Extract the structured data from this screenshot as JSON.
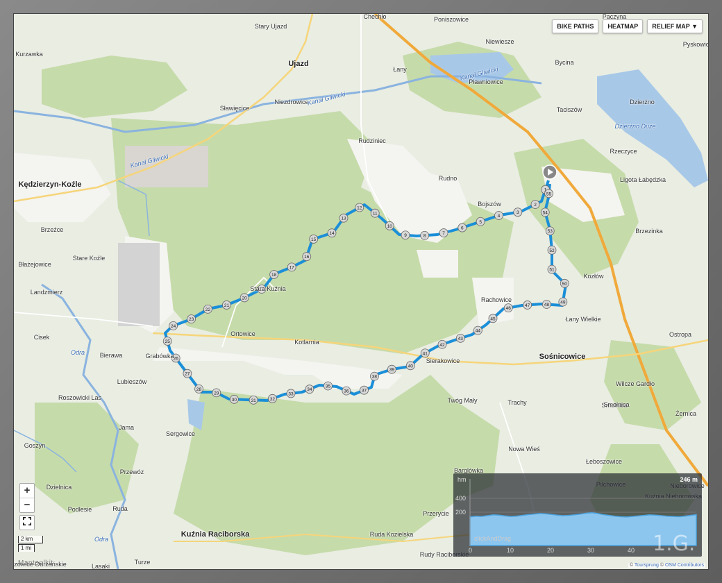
{
  "map": {
    "buttons": {
      "bike_paths": "BIKE PATHS",
      "heatmap": "HEATMAP",
      "relief_map": "RELIEF MAP ▼"
    },
    "zoom": {
      "in": "+",
      "out": "−"
    },
    "fullscreen_icon": "expand-icon",
    "scale": {
      "km": "2 km",
      "mi": "1 mi"
    },
    "logo": "Maptoolkit",
    "credits": {
      "prefix": "©",
      "toursprung": "Toursprung",
      "sep": "©",
      "osm": "OSM Contributors"
    },
    "watermark": "1.G.",
    "route_color": "#1b8fd8",
    "towns": [
      {
        "name": "Kędzierzyn-Koźle",
        "major": true
      },
      {
        "name": "Ujazd",
        "major": true
      },
      {
        "name": "Sośnicowice",
        "major": true
      },
      {
        "name": "Kuźnia Raciborska",
        "major": true
      },
      {
        "name": "Chechło"
      },
      {
        "name": "Poniszowice"
      },
      {
        "name": "Paczyna"
      },
      {
        "name": "Stary Ujazd"
      },
      {
        "name": "Kurzawka"
      },
      {
        "name": "Niewiesze"
      },
      {
        "name": "Łany"
      },
      {
        "name": "Bycina"
      },
      {
        "name": "Pławniowice"
      },
      {
        "name": "Sławięcice"
      },
      {
        "name": "Niezdrowice"
      },
      {
        "name": "Taciszów"
      },
      {
        "name": "Dzierżno"
      },
      {
        "name": "Rudziniec"
      },
      {
        "name": "Rzeczyce"
      },
      {
        "name": "Rudno"
      },
      {
        "name": "Ligota Łabędzka"
      },
      {
        "name": "Bojszów"
      },
      {
        "name": "Brzezinka"
      },
      {
        "name": "Brzeźce"
      },
      {
        "name": "Stare Koźle"
      },
      {
        "name": "Błażejowice"
      },
      {
        "name": "Landzmierz"
      },
      {
        "name": "Stara Kuźnia"
      },
      {
        "name": "Kozłów"
      },
      {
        "name": "Łany Wielkie"
      },
      {
        "name": "Rachowice"
      },
      {
        "name": "Cisek"
      },
      {
        "name": "Bierawa"
      },
      {
        "name": "Grabówka"
      },
      {
        "name": "Ortowice"
      },
      {
        "name": "Kotlarnia"
      },
      {
        "name": "Sierakowice"
      },
      {
        "name": "Smolnica"
      },
      {
        "name": "Ostropa"
      },
      {
        "name": "Lubieszów"
      },
      {
        "name": "Roszowicki Las"
      },
      {
        "name": "Twóg Mały"
      },
      {
        "name": "Trachy"
      },
      {
        "name": "Wilcze Gardło"
      },
      {
        "name": "Smolnica"
      },
      {
        "name": "Żernica"
      },
      {
        "name": "Jama"
      },
      {
        "name": "Sergowice"
      },
      {
        "name": "Nowa Wieś"
      },
      {
        "name": "Łeboszowice"
      },
      {
        "name": "Barglówka"
      },
      {
        "name": "Przewóz"
      },
      {
        "name": "Dzielnica"
      },
      {
        "name": "Podlesie"
      },
      {
        "name": "Ruda"
      },
      {
        "name": "Ruda Kozielska"
      },
      {
        "name": "Rudy Raciborskie"
      },
      {
        "name": "Turze"
      },
      {
        "name": "Lasaki"
      },
      {
        "name": "Pilchowice"
      },
      {
        "name": "Kuźnia Nieborowska"
      },
      {
        "name": "Stanica"
      },
      {
        "name": "Przerycie"
      },
      {
        "name": "Nieborowice"
      },
      {
        "name": "Roszowice Odrzańskie"
      },
      {
        "name": "Goszyn"
      },
      {
        "name": "Pyskowice"
      }
    ],
    "water_labels": [
      {
        "name": "Kanał Gliwicki"
      },
      {
        "name": "Kanał Gliwicki"
      },
      {
        "name": "Kanał Gliwicki"
      },
      {
        "name": "Dzierżno Duże"
      },
      {
        "name": "Odra"
      },
      {
        "name": "Odra"
      }
    ],
    "route_markers": [
      "1",
      "2",
      "3",
      "4",
      "5",
      "6",
      "7",
      "8",
      "9",
      "10",
      "11",
      "12",
      "13",
      "14",
      "15",
      "16",
      "17",
      "18",
      "19",
      "20",
      "21",
      "22",
      "23",
      "24",
      "25",
      "26",
      "27",
      "28",
      "29",
      "30",
      "31",
      "32",
      "33",
      "34",
      "35",
      "36",
      "37",
      "38",
      "39",
      "40",
      "41",
      "42",
      "43",
      "44",
      "45",
      "46",
      "47",
      "48",
      "49",
      "50",
      "51",
      "52",
      "53",
      "54",
      "55"
    ]
  },
  "elevation_profile": {
    "unit_y": "hm",
    "max_label": "246 m",
    "y_ticks": [
      "400",
      "200"
    ],
    "x_ticks": [
      "0",
      "10",
      "20",
      "30",
      "40"
    ],
    "placeholder": "clickAndDrag",
    "y_range": [
      0,
      500
    ],
    "profile_values": [
      215,
      220,
      218,
      224,
      230,
      228,
      222,
      218,
      220,
      226,
      232,
      236,
      240,
      238,
      234,
      228,
      224,
      226,
      230,
      236,
      242,
      246,
      240,
      232,
      226,
      220,
      216,
      214,
      218,
      222,
      226,
      230,
      228,
      224,
      220,
      218,
      216,
      220,
      226,
      232
    ]
  }
}
